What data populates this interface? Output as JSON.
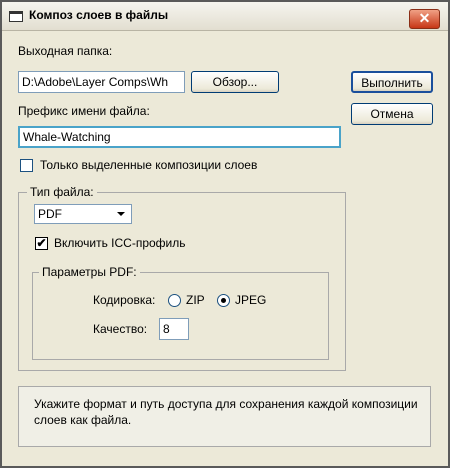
{
  "window": {
    "title": "Композ слоев в файлы",
    "close_glyph": "✕"
  },
  "output": {
    "label": "Выходная папка:",
    "path_value": "D:\\Adobe\\Layer Comps\\Wh",
    "browse_label": "Обзор..."
  },
  "actions": {
    "run_label": "Выполнить",
    "cancel_label": "Отмена"
  },
  "prefix": {
    "label": "Префикс имени файла:",
    "value": "Whale-Watching"
  },
  "selected_only": {
    "label": "Только выделенные композиции слоев",
    "checked": false
  },
  "file_type": {
    "legend": "Тип файла:",
    "selected": "PDF",
    "icc_label": "Включить ICC-профиль",
    "icc_checked": true,
    "check_glyph": "✔"
  },
  "pdf_options": {
    "legend": "Параметры PDF:",
    "encoding_label": "Кодировка:",
    "zip_label": "ZIP",
    "jpeg_label": "JPEG",
    "encoding_selected": "JPEG",
    "quality_label": "Качество:",
    "quality_value": "8"
  },
  "help_text": "Укажите формат и путь доступа для сохранения каждой композиции слоев как файла.",
  "colors": {
    "close_button": "#c73616",
    "field_border": "#7f9db9",
    "dialog_bg": "#ece9d8"
  }
}
